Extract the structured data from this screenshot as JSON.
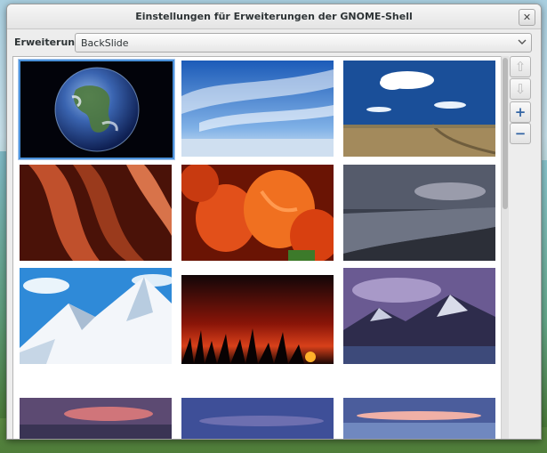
{
  "window": {
    "title": "Einstellungen für Erweiterungen der GNOME-Shell",
    "close_glyph": "✕"
  },
  "extension_row": {
    "label": "Erweiterung",
    "selected": "BackSlide"
  },
  "toolbar": {
    "move_up_glyph": "⇧",
    "move_down_glyph": "⇩",
    "add_glyph": "+",
    "remove_glyph": "−"
  },
  "colors": {
    "selection": "#4a90d9",
    "accent": "#3465a4"
  },
  "wallpapers": [
    {
      "subject": "earth-from-space",
      "selected": true
    },
    {
      "subject": "blue-sky-clouds",
      "selected": false
    },
    {
      "subject": "prairie-road-clouds",
      "selected": false
    },
    {
      "subject": "red-canyon",
      "selected": false
    },
    {
      "subject": "orange-tulips",
      "selected": false
    },
    {
      "subject": "dark-seashore",
      "selected": false
    },
    {
      "subject": "snowy-mountain",
      "selected": false
    },
    {
      "subject": "red-sunset-grass",
      "selected": false
    },
    {
      "subject": "purple-mountains",
      "selected": false
    },
    {
      "subject": "dusk-horizon",
      "selected": false
    },
    {
      "subject": "blue-dusk-sky",
      "selected": false
    },
    {
      "subject": "sunset-lake",
      "selected": false
    }
  ]
}
